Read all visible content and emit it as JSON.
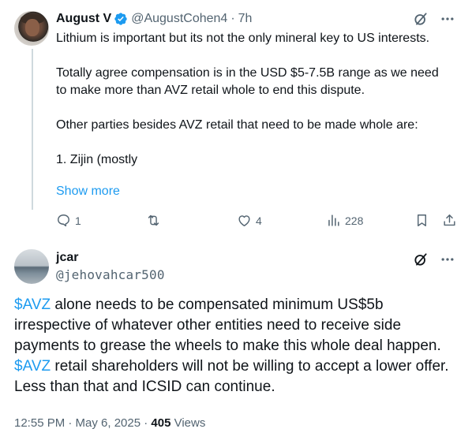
{
  "tweet1": {
    "author_name": "August V",
    "author_handle": "@AugustCohen4",
    "separator": "·",
    "time": "7h",
    "paragraphs": [
      "Lithium is important but its not the only mineral key to US interests.",
      "Totally agree compensation is in the USD $5-7.5B range as we need to make more than AVZ retail whole to end this dispute.",
      "Other parties besides AVZ retail that need to be made whole are:",
      "1. Zijin (mostly"
    ],
    "show_more": "Show more",
    "counts": {
      "replies": "1",
      "reposts": "",
      "likes": "4",
      "views": "228"
    },
    "icons": [
      "grok-icon",
      "more-icon",
      "reply-icon",
      "repost-icon",
      "like-icon",
      "views-icon",
      "bookmark-icon",
      "share-icon"
    ]
  },
  "tweet2": {
    "author_name": "jcar",
    "author_handle": "@jehovahcar500",
    "text_parts": [
      {
        "text": "$AVZ",
        "cashtag": true
      },
      {
        "text": " alone needs to be compensated minimum US$5b irrespective of whatever other entities need to receive side payments to grease the wheels to make this whole deal happen. ",
        "cashtag": false
      },
      {
        "text": "$AVZ",
        "cashtag": true
      },
      {
        "text": " retail shareholders will not be willing to accept a lower offer. Less than that and ICSID can continue.",
        "cashtag": false
      }
    ],
    "timestamp": "12:55 PM · May 6, 2025 · ",
    "views_count": "405",
    "views_label": " Views"
  },
  "colors": {
    "accent": "#1d9bf0",
    "text": "#0f1419",
    "muted": "#536471",
    "line": "#cfd9de"
  }
}
